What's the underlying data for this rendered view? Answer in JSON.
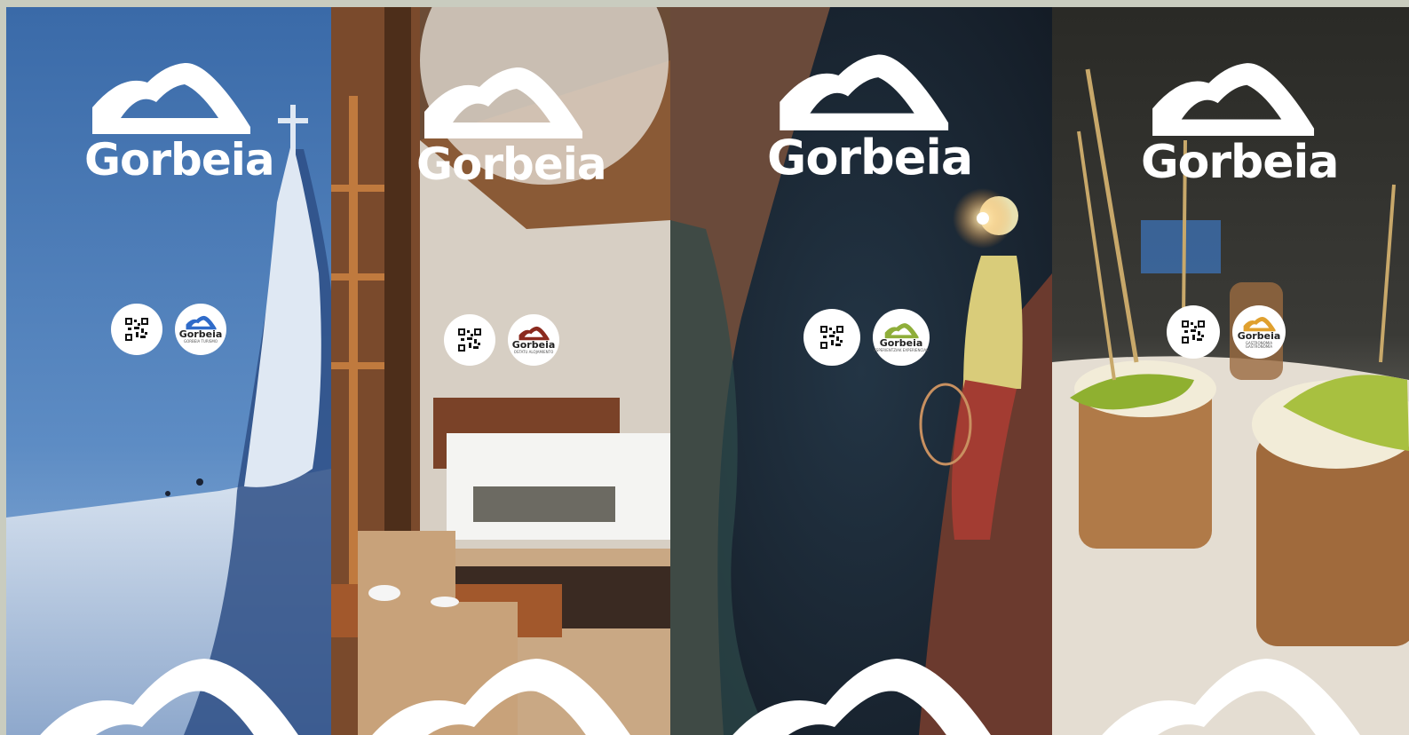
{
  "panels": [
    {
      "id": "snow",
      "wordmark": "Gorbeia",
      "badge_word": "Gorbeia",
      "badge_sub": "GORBEIA TURISMO",
      "badge_color": "#2f6bc9",
      "scene": "snowy summit with ice-covered cross"
    },
    {
      "id": "room",
      "wordmark": "Gorbeia",
      "badge_word": "Gorbeia",
      "badge_sub": "OSTATU ALOJAMIENTO",
      "badge_color": "#8b2a1e",
      "scene": "rustic bedroom with wicker chairs"
    },
    {
      "id": "cave",
      "wordmark": "Gorbeia",
      "badge_word": "Gorbeia",
      "badge_sub": "ESPERIENTZIAK EXPERIENCIAS",
      "badge_color": "#8fae3a",
      "scene": "caver with headlamp and rope"
    },
    {
      "id": "food",
      "wordmark": "Gorbeia",
      "badge_word": "Gorbeia",
      "badge_sub": "GASTRONOMIA GASTRONOMIA",
      "badge_color": "#e0a02e",
      "scene": "pintxos on skewers"
    }
  ]
}
